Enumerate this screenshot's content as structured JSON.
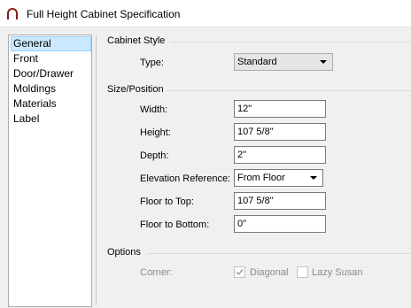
{
  "window": {
    "title": "Full Height Cabinet Specification"
  },
  "sidebar": {
    "items": [
      {
        "label": "General",
        "selected": true
      },
      {
        "label": "Front"
      },
      {
        "label": "Door/Drawer"
      },
      {
        "label": "Moldings"
      },
      {
        "label": "Materials"
      },
      {
        "label": "Label"
      }
    ]
  },
  "cabinet_style": {
    "heading": "Cabinet Style",
    "type_label": "Type:",
    "type_value": "Standard"
  },
  "size_position": {
    "heading": "Size/Position",
    "width_label": "Width:",
    "width_value": "12\"",
    "height_label": "Height:",
    "height_value": "107 5/8\"",
    "depth_label": "Depth:",
    "depth_value": "2\"",
    "elevation_label": "Elevation Reference:",
    "elevation_value": "From Floor",
    "floor_top_label": "Floor to Top:",
    "floor_top_value": "107 5/8\"",
    "floor_bottom_label": "Floor to Bottom:",
    "floor_bottom_value": "0\""
  },
  "options": {
    "heading": "Options",
    "corner_label": "Corner:",
    "diagonal_label": "Diagonal",
    "diagonal_checked": true,
    "lazy_susan_label": "Lazy Susan",
    "lazy_susan_checked": false
  },
  "colors": {
    "selection": "#cce8ff",
    "app_icon": "#8b1a1a",
    "disabled_text": "#8a8a8a"
  }
}
